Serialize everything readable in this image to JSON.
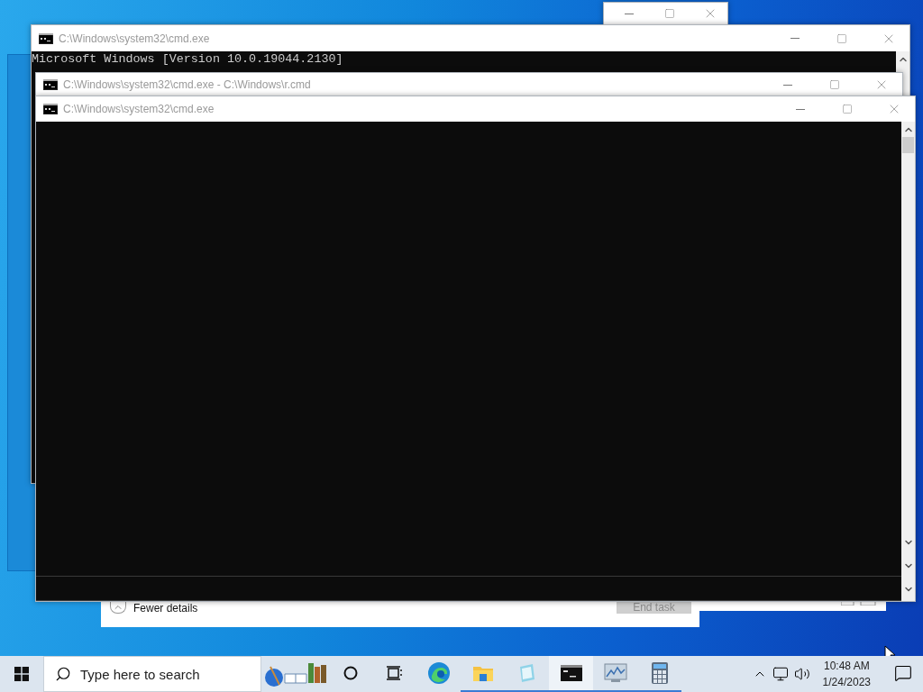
{
  "console_windows": [
    {
      "title": "C:\\Windows\\system32\\cmd.exe",
      "lines": [
        "Microsoft Windows [Version 10.0.19044.2130]"
      ]
    },
    {
      "title": "C:\\Windows\\system32\\cmd.exe - C:\\Windows\\r.cmd"
    },
    {
      "title": "C:\\Windows\\system32\\cmd.exe"
    }
  ],
  "task_manager": {
    "details_toggle": "Fewer details",
    "end_task": {
      "label": "End task",
      "disabled": true
    }
  },
  "taskbar": {
    "search_placeholder": "Type here to search",
    "apps": [
      {
        "kind": "edge",
        "running": false,
        "selected": false
      },
      {
        "kind": "explorer",
        "running": true,
        "selected": false
      },
      {
        "kind": "notepad",
        "running": true,
        "selected": false
      },
      {
        "kind": "terminal",
        "running": true,
        "selected": true
      },
      {
        "kind": "monitor",
        "running": true,
        "selected": false
      },
      {
        "kind": "calculator",
        "running": true,
        "selected": false
      }
    ],
    "time": "10:48 AM",
    "date": "1/24/2023"
  }
}
